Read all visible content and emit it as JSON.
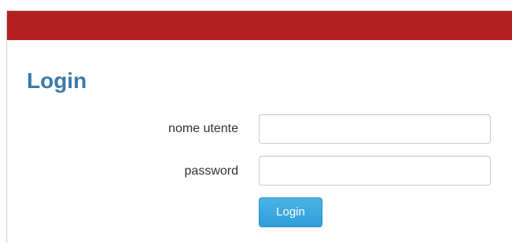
{
  "header": {
    "bar_color": "#b32024"
  },
  "page": {
    "title": "Login",
    "title_color": "#3a7aaa"
  },
  "form": {
    "username_label": "nome utente",
    "username_value": "",
    "username_placeholder": "",
    "password_label": "password",
    "password_value": "",
    "password_placeholder": "",
    "submit_label": "Login",
    "submit_color": "#2f9fdb"
  }
}
